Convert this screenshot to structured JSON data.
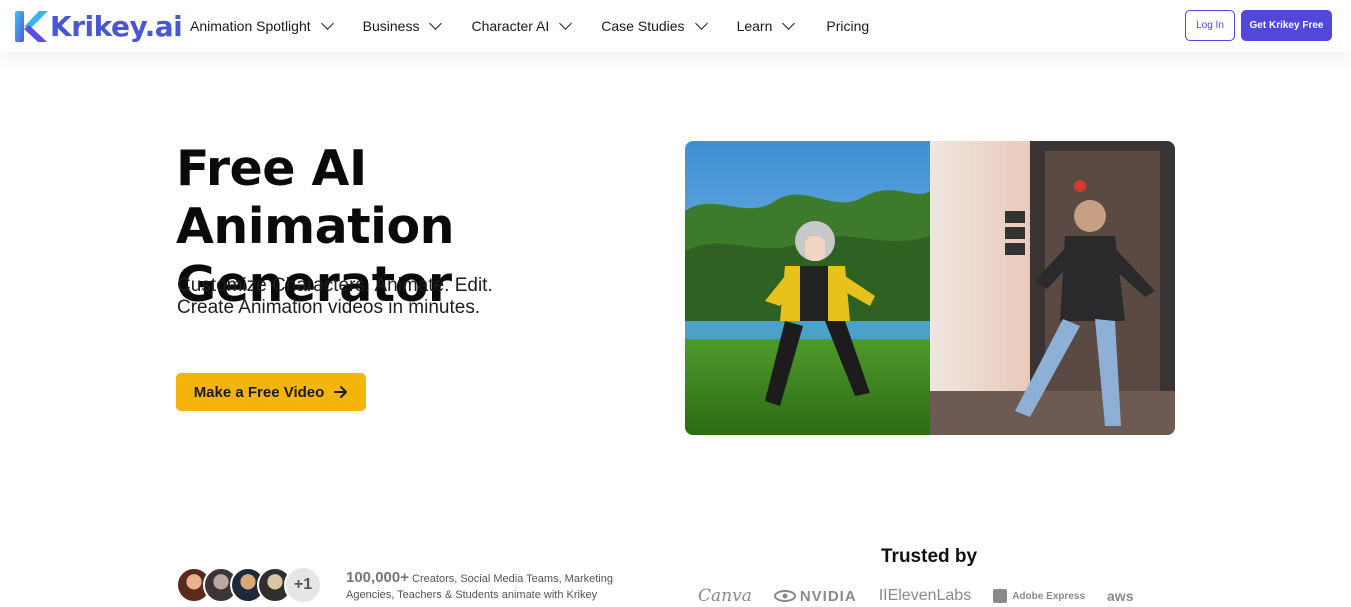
{
  "brand": {
    "name": "Krikey.ai",
    "primary_color": "#5147d9",
    "accent_color": "#f5b40a"
  },
  "nav": {
    "items": [
      {
        "label": "Animation Spotlight",
        "has_dropdown": true
      },
      {
        "label": "Business",
        "has_dropdown": true
      },
      {
        "label": "Character AI",
        "has_dropdown": true
      },
      {
        "label": "Case Studies",
        "has_dropdown": true
      },
      {
        "label": "Learn",
        "has_dropdown": true
      },
      {
        "label": "Pricing",
        "has_dropdown": false
      }
    ],
    "login_label": "Log In",
    "signup_label": "Get Krikey Free"
  },
  "hero": {
    "title_line1": "Free AI Animation",
    "title_line2": "Generator",
    "subtitle_line1": "Customize Characters. Animate. Edit.",
    "subtitle_line2": "Create Animation videos in minutes.",
    "cta_label": "Make a Free Video"
  },
  "social_proof": {
    "extra_count": "+1",
    "count": "100,000+",
    "text": "Creators, Social Media Teams, Marketing Agencies, Teachers & Students animate with Krikey"
  },
  "trusted": {
    "heading": "Trusted by",
    "logos": [
      "Canva",
      "NVIDIA",
      "IIElevenLabs",
      "Adobe Express",
      "aws"
    ]
  }
}
